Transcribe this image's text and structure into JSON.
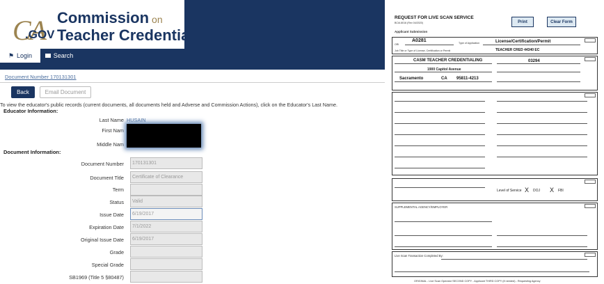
{
  "header": {
    "logo_ca": "CA",
    "logo_gov": ".GOV",
    "title_line1": "Commission",
    "title_on": "on",
    "title_line2": "Teacher Credentialing"
  },
  "nav": {
    "login": "Login",
    "search": "Search"
  },
  "document_link": "Document Number 170131301",
  "buttons": {
    "back": "Back",
    "email": "Email Document"
  },
  "instructions": "To view the educator's public records (current documents, all documents held and Adverse and Commission Actions), click on the Educator's Last Name.",
  "educator": {
    "section": "Educator Information:",
    "last_name_label": "Last Name",
    "last_name_value": "HUSAIN",
    "first_name_label": "First Nam",
    "middle_name_label": "Middle Nam"
  },
  "document": {
    "section": "Document Information:",
    "fields": [
      {
        "label": "Document Number",
        "value": "170131301"
      },
      {
        "label": "Document Title",
        "value": "Certificate of Clearance"
      },
      {
        "label": "Term",
        "value": ""
      },
      {
        "label": "Status",
        "value": "Valid"
      },
      {
        "label": "Issue Date",
        "value": "6/19/2017"
      },
      {
        "label": "Expiration Date",
        "value": "7/1/2022"
      },
      {
        "label": "Original Issue Date",
        "value": "6/19/2017"
      },
      {
        "label": "Grade",
        "value": ""
      },
      {
        "label": "Special Grade",
        "value": ""
      },
      {
        "label": "SB1969 (Title 5 §80487)",
        "value": ""
      }
    ]
  },
  "form": {
    "title": "REQUEST FOR LIVE SCAN SERVICE",
    "subtitle": "Applicant Submission",
    "print": "Print",
    "clear": "Clear Form",
    "ori_label": "ORI",
    "ori_value": "A0281",
    "type_of_application_label": "Type of Application",
    "type_of_application_value": "License/Certification/Permit",
    "job_title_label": "Job Title or Type of License, Certification or Permit",
    "job_title_value": "TEACHER CRED 44340 EC",
    "agency_name": "CASM TEACHER CREDENTIALING",
    "mail_code": "03294",
    "street": "1900 Capitol Avenue",
    "city": "Sacramento",
    "state": "CA",
    "zip": "95811-4213",
    "level_label": "Level of Service",
    "doj": "DOJ",
    "fbi": "FBI",
    "agency_section": "SUPPLEMENTAL AGENCY/EMPLOYER",
    "live_scan": "Live Scan Transaction Completed By:",
    "footer": "ORIGINAL - Live Scan Operator  SECOND COPY - Applicant  THIRD COPY (if needed) - Requesting Agency"
  }
}
